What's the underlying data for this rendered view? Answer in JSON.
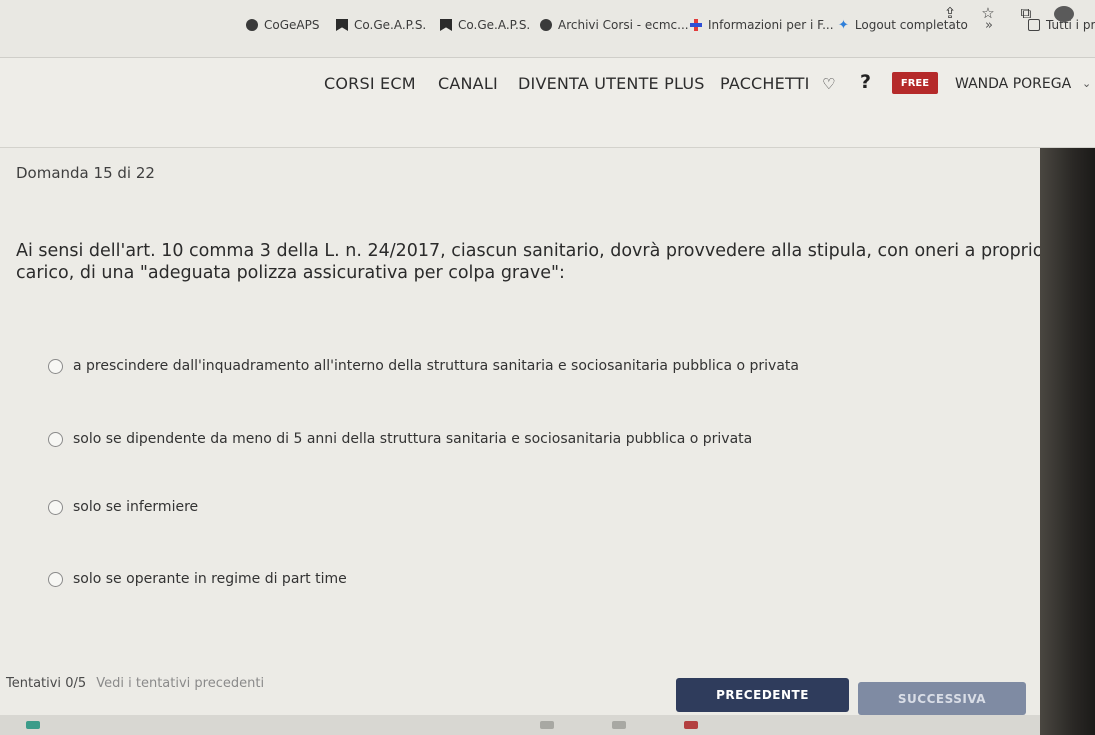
{
  "bookmarks": [
    {
      "label": "CoGeAPS",
      "icon": "globe-icon"
    },
    {
      "label": "Co.Ge.A.P.S.",
      "icon": "bookmark-icon"
    },
    {
      "label": "Co.Ge.A.P.S.",
      "icon": "bookmark-icon"
    },
    {
      "label": "Archivi Corsi - ecmc...",
      "icon": "globe-icon"
    },
    {
      "label": "Informazioni per i F...",
      "icon": "cross-icon"
    },
    {
      "label": "Logout completato",
      "icon": "spark-icon"
    }
  ],
  "bookmarks_more": "»",
  "all_bookmarks": "Tutti i pre",
  "nav": {
    "items": [
      "CORSI ECM",
      "CANALI",
      "DIVENTA UTENTE PLUS",
      "PACCHETTI"
    ],
    "help": "?",
    "free_badge": "FREE",
    "user": "WANDA POREGA"
  },
  "quiz": {
    "counter": "Domanda 15 di 22",
    "question": "Ai sensi dell'art. 10 comma 3 della L. n. 24/2017, ciascun sanitario, dovrà provvedere alla stipula, con oneri a proprio carico, di una \"adeguata polizza assicurativa per colpa grave\":",
    "options": [
      "a prescindere dall'inquadramento all'interno della struttura sanitaria e sociosanitaria pubblica o privata",
      "solo se dipendente da meno di 5 anni della struttura sanitaria e sociosanitaria pubblica o privata",
      "solo se infermiere",
      "solo se operante in regime di part time"
    ],
    "attempts_label": "Tentativi",
    "attempts_value": "0/5",
    "attempts_link": "Vedi i tentativi precedenti",
    "prev_label": "PRECEDENTE",
    "next_label": "SUCCESSIVA"
  }
}
